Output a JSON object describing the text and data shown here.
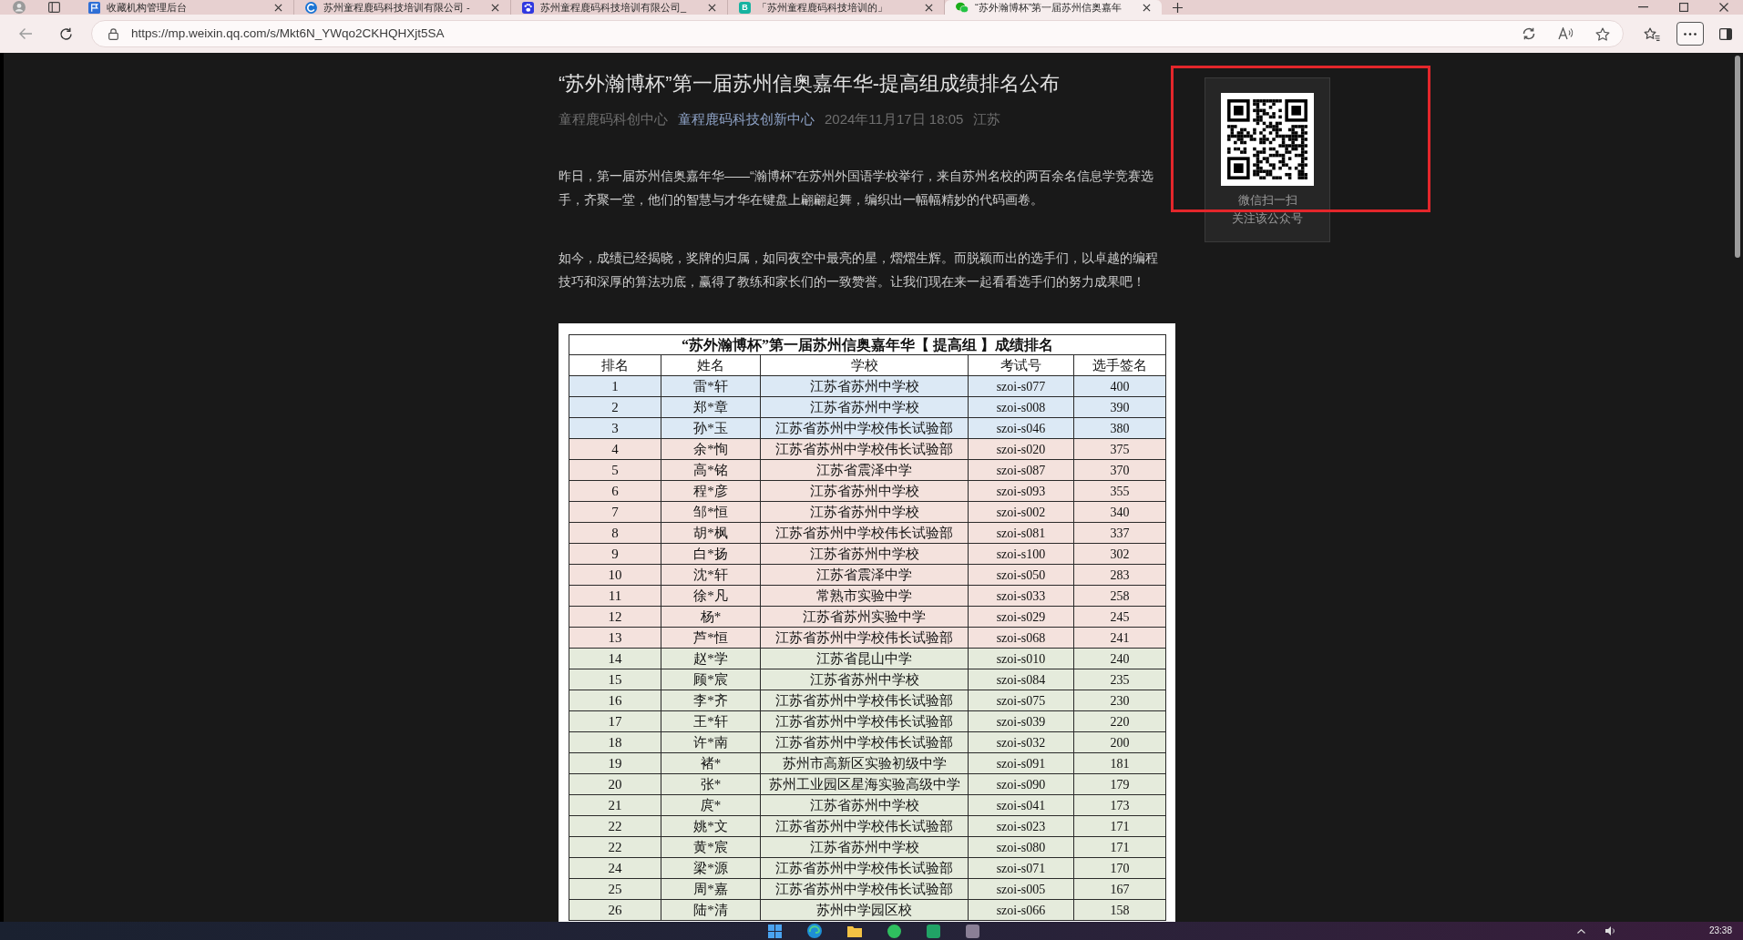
{
  "browser": {
    "tabs": [
      {
        "kind": "flag",
        "title": "收藏机构管理后台",
        "selected": false
      },
      {
        "kind": "swirl",
        "title": "苏州童程鹿码科技培训有限公司 -",
        "selected": false
      },
      {
        "kind": "paw",
        "title": "苏州童程鹿码科技培训有限公司_",
        "selected": false
      },
      {
        "kind": "letter",
        "icon_letter": "B",
        "title": "「苏州童程鹿码科技培训的」",
        "selected": false
      },
      {
        "kind": "chat",
        "title": "“苏外瀚博杯”第一届苏州信奥嘉年",
        "selected": true
      }
    ],
    "address_bar": {
      "url": "https://mp.weixin.qq.com/s/Mkt6N_YWqo2CKHQHXjt5SA"
    }
  },
  "article": {
    "title": "“苏外瀚博杯”第一届苏州信奥嘉年华-提高组成绩排名公布",
    "meta": {
      "account": "童程鹿码科创中心",
      "author_link": "童程鹿码科技创新中心",
      "date": "2024年11月17日 18:05",
      "location": "江苏"
    },
    "paragraphs": [
      "昨日，第一届苏州信奥嘉年华——“瀚博杯”在苏州外国语学校举行，来自苏州名校的两百余名信息学竞赛选手，齐聚一堂，他们的智慧与才华在键盘上翩翩起舞，编织出一幅幅精妙的代码画卷。",
      "如今，成绩已经揭晓，奖牌的归属，如同夜空中最亮的星，熠熠生辉。而脱颖而出的选手们，以卓越的编程技巧和深厚的算法功底，赢得了教练和家长们的一致赞誉。让我们现在来一起看看选手们的努力成果吧！"
    ],
    "table_image": {
      "caption": "“苏外瀚博杯”第一届苏州信奥嘉年华【 提高组 】成绩排名",
      "columns": [
        "排名",
        "姓名",
        "学校",
        "考试号",
        "选手签名"
      ],
      "rows": [
        {
          "cells": [
            "1",
            "雷*轩",
            "江苏省苏州中学校",
            "szoi-s077",
            "400"
          ],
          "color": "#dce9f5"
        },
        {
          "cells": [
            "2",
            "郑*章",
            "江苏省苏州中学校",
            "szoi-s008",
            "390"
          ],
          "color": "#dce9f5"
        },
        {
          "cells": [
            "3",
            "孙*玉",
            "江苏省苏州中学校伟长试验部",
            "szoi-s046",
            "380"
          ],
          "color": "#dce9f5"
        },
        {
          "cells": [
            "4",
            "余*恂",
            "江苏省苏州中学校伟长试验部",
            "szoi-s020",
            "375"
          ],
          "color": "#f4e2dd"
        },
        {
          "cells": [
            "5",
            "高*铭",
            "江苏省震泽中学",
            "szoi-s087",
            "370"
          ],
          "color": "#f4e2dd"
        },
        {
          "cells": [
            "6",
            "程*彦",
            "江苏省苏州中学校",
            "szoi-s093",
            "355"
          ],
          "color": "#f4e2dd"
        },
        {
          "cells": [
            "7",
            "邹*恒",
            "江苏省苏州中学校",
            "szoi-s002",
            "340"
          ],
          "color": "#f4e2dd"
        },
        {
          "cells": [
            "8",
            "胡*枫",
            "江苏省苏州中学校伟长试验部",
            "szoi-s081",
            "337"
          ],
          "color": "#f4e2dd"
        },
        {
          "cells": [
            "9",
            "白*扬",
            "江苏省苏州中学校",
            "szoi-s100",
            "302"
          ],
          "color": "#f4e2dd"
        },
        {
          "cells": [
            "10",
            "沈*轩",
            "江苏省震泽中学",
            "szoi-s050",
            "283"
          ],
          "color": "#f4e2dd"
        },
        {
          "cells": [
            "11",
            "徐*凡",
            "常熟市实验中学",
            "szoi-s033",
            "258"
          ],
          "color": "#f4e2dd"
        },
        {
          "cells": [
            "12",
            "杨*",
            "江苏省苏州实验中学",
            "szoi-s029",
            "245"
          ],
          "color": "#f4e2dd"
        },
        {
          "cells": [
            "13",
            "芦*恒",
            "江苏省苏州中学校伟长试验部",
            "szoi-s068",
            "241"
          ],
          "color": "#f4e2dd"
        },
        {
          "cells": [
            "14",
            "赵*学",
            "江苏省昆山中学",
            "szoi-s010",
            "240"
          ],
          "color": "#e5ebdc"
        },
        {
          "cells": [
            "15",
            "顾*宸",
            "江苏省苏州中学校",
            "szoi-s084",
            "235"
          ],
          "color": "#e5ebdc"
        },
        {
          "cells": [
            "16",
            "李*齐",
            "江苏省苏州中学校伟长试验部",
            "szoi-s075",
            "230"
          ],
          "color": "#e5ebdc"
        },
        {
          "cells": [
            "17",
            "王*轩",
            "江苏省苏州中学校伟长试验部",
            "szoi-s039",
            "220"
          ],
          "color": "#e5ebdc"
        },
        {
          "cells": [
            "18",
            "许*南",
            "江苏省苏州中学校伟长试验部",
            "szoi-s032",
            "200"
          ],
          "color": "#e5ebdc"
        },
        {
          "cells": [
            "19",
            "褚*",
            "苏州市高新区实验初级中学",
            "szoi-s091",
            "181"
          ],
          "color": "#e5ebdc"
        },
        {
          "cells": [
            "20",
            "张*",
            "苏州工业园区星海实验高级中学",
            "szoi-s090",
            "179"
          ],
          "color": "#e5ebdc"
        },
        {
          "cells": [
            "21",
            "庹*",
            "江苏省苏州中学校",
            "szoi-s041",
            "173"
          ],
          "color": "#e5ebdc"
        },
        {
          "cells": [
            "22",
            "姚*文",
            "江苏省苏州中学校伟长试验部",
            "szoi-s023",
            "171"
          ],
          "color": "#e5ebdc"
        },
        {
          "cells": [
            "22",
            "黄*宸",
            "江苏省苏州中学校",
            "szoi-s080",
            "171"
          ],
          "color": "#e5ebdc"
        },
        {
          "cells": [
            "24",
            "梁*源",
            "江苏省苏州中学校伟长试验部",
            "szoi-s071",
            "170"
          ],
          "color": "#e5ebdc"
        },
        {
          "cells": [
            "25",
            "周*嘉",
            "江苏省苏州中学校伟长试验部",
            "szoi-s005",
            "167"
          ],
          "color": "#e5ebdc"
        },
        {
          "cells": [
            "26",
            "陆*清",
            "苏州中学园区校",
            "szoi-s066",
            "158"
          ],
          "color": "#e5ebdc"
        }
      ]
    }
  },
  "qr_panel": {
    "lines": [
      "微信扫一扫",
      "关注该公众号"
    ]
  },
  "taskbar": {
    "time": "23:38"
  }
}
